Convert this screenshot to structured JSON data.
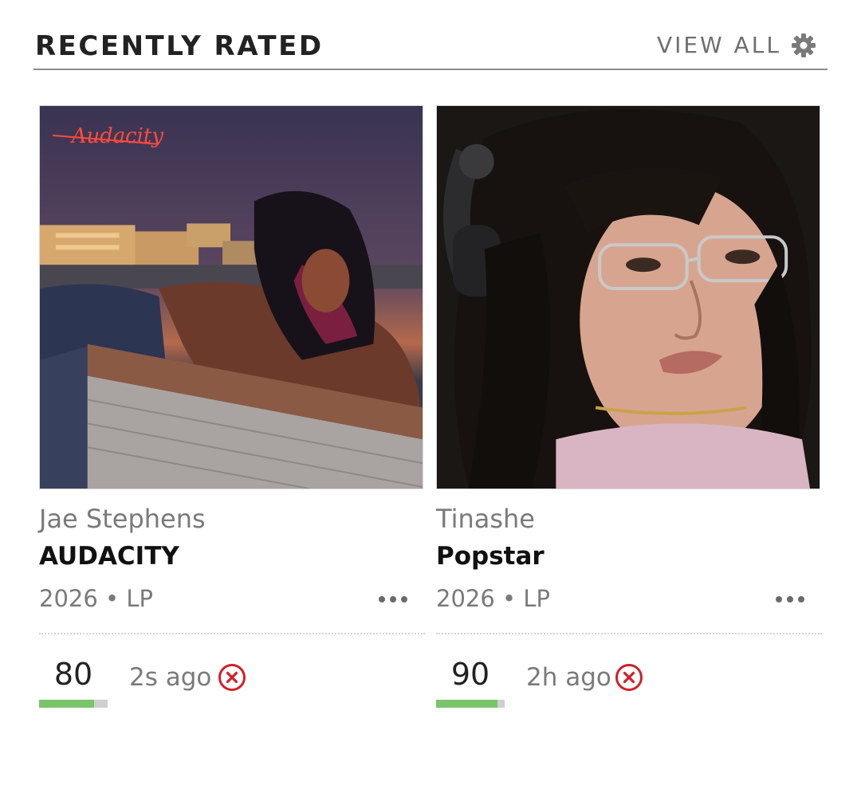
{
  "header": {
    "title": "RECENTLY RATED",
    "view_all_label": "VIEW ALL",
    "settings_icon": "gear-icon"
  },
  "items": [
    {
      "artist": "Jae Stephens",
      "album": "AUDACITY",
      "meta": "2026 • LP",
      "score": "80",
      "score_fraction": 0.8,
      "time": "2s ago",
      "cover_art_text": "Audacity",
      "more_icon": "more-horizontal-icon",
      "remove_icon": "remove-circle-icon"
    },
    {
      "artist": "Tinashe",
      "album": "Popstar",
      "meta": "2026 • LP",
      "score": "90",
      "score_fraction": 0.9,
      "time": "2h ago",
      "more_icon": "more-horizontal-icon",
      "remove_icon": "remove-circle-icon"
    }
  ],
  "colors": {
    "score_bar_fill": "#7ac46a",
    "score_bar_track": "#cfcfcf",
    "remove_red": "#d0202a",
    "divider": "#8c8c8c"
  }
}
